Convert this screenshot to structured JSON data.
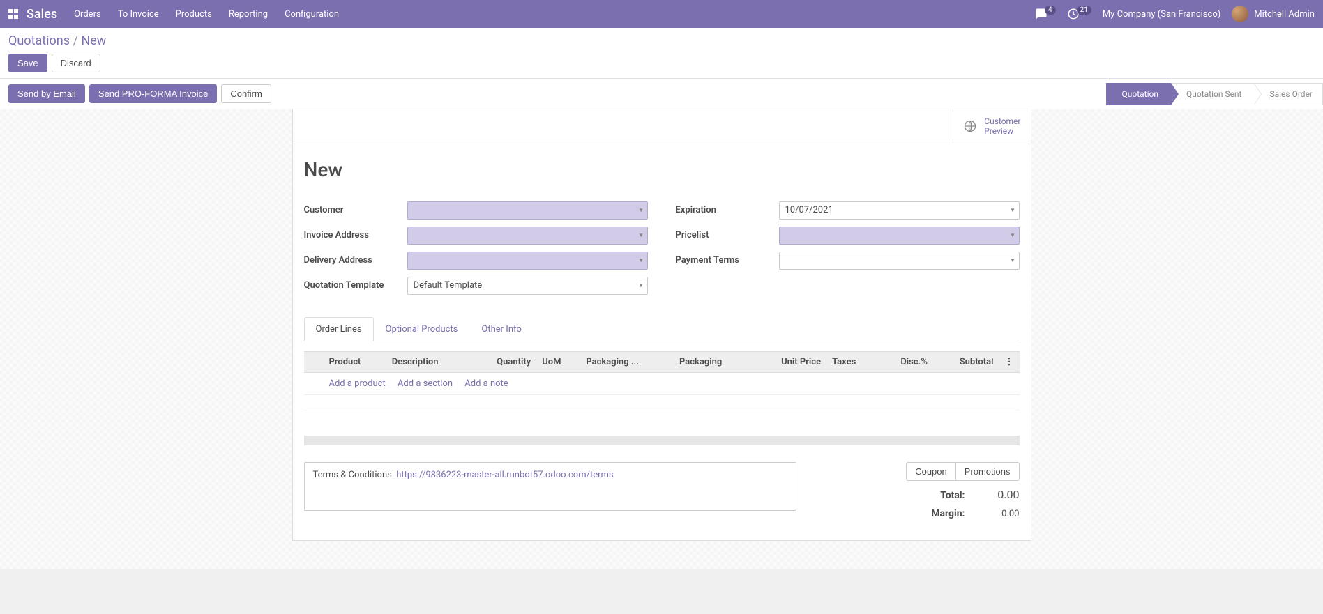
{
  "topnav": {
    "app_title": "Sales",
    "items": [
      "Orders",
      "To Invoice",
      "Products",
      "Reporting",
      "Configuration"
    ],
    "messages_badge": "4",
    "activities_badge": "21",
    "company": "My Company (San Francisco)",
    "user": "Mitchell Admin"
  },
  "breadcrumb": {
    "parent": "Quotations",
    "sep": "/",
    "current": "New"
  },
  "buttons": {
    "save": "Save",
    "discard": "Discard",
    "send_email": "Send by Email",
    "send_proforma": "Send PRO-FORMA Invoice",
    "confirm": "Confirm",
    "coupon": "Coupon",
    "promotions": "Promotions"
  },
  "stages": [
    "Quotation",
    "Quotation Sent",
    "Sales Order"
  ],
  "active_stage_index": 0,
  "customer_preview": {
    "line1": "Customer",
    "line2": "Preview"
  },
  "record": {
    "title": "New"
  },
  "fields": {
    "customer_label": "Customer",
    "invoice_address_label": "Invoice Address",
    "delivery_address_label": "Delivery Address",
    "quotation_template_label": "Quotation Template",
    "quotation_template_value": "Default Template",
    "expiration_label": "Expiration",
    "expiration_value": "10/07/2021",
    "pricelist_label": "Pricelist",
    "payment_terms_label": "Payment Terms"
  },
  "tabs": [
    "Order Lines",
    "Optional Products",
    "Other Info"
  ],
  "active_tab_index": 0,
  "table": {
    "headers": [
      "Product",
      "Description",
      "Quantity",
      "UoM",
      "Packaging ...",
      "Packaging",
      "Unit Price",
      "Taxes",
      "Disc.%",
      "Subtotal"
    ],
    "add_product": "Add a product",
    "add_section": "Add a section",
    "add_note": "Add a note"
  },
  "terms": {
    "label": "Terms & Conditions: ",
    "url_text": "https://9836223-master-all.runbot57.odoo.com/terms"
  },
  "totals": {
    "total_label": "Total:",
    "total_value": "0.00",
    "margin_label": "Margin:",
    "margin_value": "0.00"
  }
}
